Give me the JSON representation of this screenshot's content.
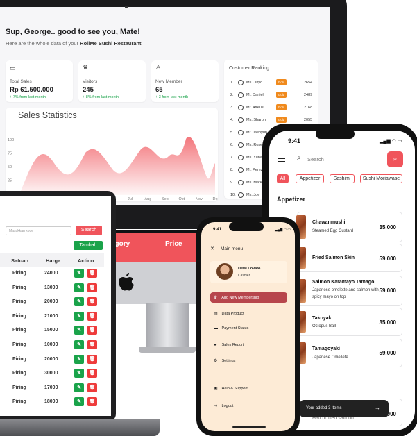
{
  "dashboard": {
    "greeting": "Sup, George.. good to see you, Mate!",
    "subtitle_prefix": "Here are the whole data of your ",
    "subtitle_bold": "RollMe Sushi Restaurant",
    "stats": [
      {
        "icon": "card-icon",
        "label": "Total Sales",
        "value": "Rp 61.500.000",
        "delta": "+ 7% from last month"
      },
      {
        "icon": "crown-icon",
        "label": "Visitors",
        "value": "245",
        "delta": "+ 8% from last month"
      },
      {
        "icon": "user-icon",
        "label": "New Member",
        "value": "65",
        "delta": "+ 3 from last month"
      }
    ],
    "sales_title": "Sales Statistics",
    "chart_data": {
      "type": "area",
      "title": "Sales Statistics",
      "y_ticks": [
        "100",
        "75",
        "50",
        "25",
        "0"
      ],
      "x_ticks": [
        "Jul",
        "Aug",
        "Sep",
        "Oct",
        "Nov",
        "Dec"
      ],
      "ylim": [
        0,
        100
      ],
      "color": "#f0545b"
    },
    "ranking_title": "Customer Ranking",
    "ranking": [
      {
        "n": "1.",
        "name": "Ms. Jihyo",
        "badge": "Gold",
        "points": "2654"
      },
      {
        "n": "2.",
        "name": "Mr. Daniel",
        "badge": "Gold",
        "points": "2489"
      },
      {
        "n": "3.",
        "name": "Mr. Atreus",
        "badge": "Gold",
        "points": "2168"
      },
      {
        "n": "4.",
        "name": "Ms. Sharon",
        "badge": "Gold",
        "points": "2055"
      },
      {
        "n": "5.",
        "name": "Mr. Jaehyun",
        "badge": "",
        "points": ""
      },
      {
        "n": "6.",
        "name": "Ms. Rose",
        "badge": "",
        "points": ""
      },
      {
        "n": "7.",
        "name": "Ms. Yuna",
        "badge": "",
        "points": ""
      },
      {
        "n": "8.",
        "name": "Mr. Perez",
        "badge": "",
        "points": ""
      },
      {
        "n": "9.",
        "name": "Ms. Mark",
        "badge": "",
        "points": ""
      },
      {
        "n": "10.",
        "name": "Ms. Joe",
        "badge": "",
        "points": ""
      }
    ]
  },
  "imac": {
    "col1": "egory",
    "col2": "Price"
  },
  "laptop": {
    "search_placeholder": "Masukkan kode",
    "search_button": "Search",
    "add_button": "Tambah",
    "headers": [
      "Satuan",
      "Harga",
      "Action"
    ],
    "rows": [
      {
        "unit": "Piring",
        "price": "24000"
      },
      {
        "unit": "Piring",
        "price": "13000"
      },
      {
        "unit": "Piring",
        "price": "20000"
      },
      {
        "unit": "Piring",
        "price": "21000"
      },
      {
        "unit": "Piring",
        "price": "15000"
      },
      {
        "unit": "Piring",
        "price": "10000"
      },
      {
        "unit": "Piring",
        "price": "20000"
      },
      {
        "unit": "Piring",
        "price": "30000"
      },
      {
        "unit": "Piring",
        "price": "17000"
      },
      {
        "unit": "Piring",
        "price": "18000"
      }
    ]
  },
  "menu_app": {
    "time": "9:41",
    "search_placeholder": "Search",
    "chips": [
      "All",
      "Appetizer",
      "Sashimi",
      "Sushi Moriawase"
    ],
    "section": "Appetizer",
    "items": [
      {
        "name": "Chawanmushi",
        "desc": "Steamed Egg Custard",
        "price": "35.000"
      },
      {
        "name": "Fried Salmon Skin",
        "desc": "",
        "price": "59.000"
      },
      {
        "name": "Salmon Karamayo Tamago",
        "desc": "Japanese omelette and salmon with spicy mayo on top",
        "price": "59.000"
      },
      {
        "name": "Takoyaki",
        "desc": "Octopus Ball",
        "price": "35.000"
      },
      {
        "name": "Tamagoyaki",
        "desc": "Japanese Omellete",
        "price": "59.000"
      }
    ],
    "cart_text": "Your added 3 items",
    "cart_arrow": "→",
    "peek_item": "Half broiled salmon",
    "peek_price": "59.000"
  },
  "side_menu": {
    "time": "9:41",
    "title": "Main menu",
    "user_name": "Dewi Lovato",
    "user_role": "Cashier",
    "items": [
      {
        "icon": "crown-icon",
        "label": "Add New Membership"
      },
      {
        "icon": "document-icon",
        "label": "Data Product"
      },
      {
        "icon": "card-icon",
        "label": "Payment Status"
      },
      {
        "icon": "folder-icon",
        "label": "Sales Report"
      },
      {
        "icon": "gear-icon",
        "label": "Settings"
      },
      {
        "icon": "help-icon",
        "label": "Help & Support"
      },
      {
        "icon": "logout-icon",
        "label": "Logout"
      }
    ]
  }
}
